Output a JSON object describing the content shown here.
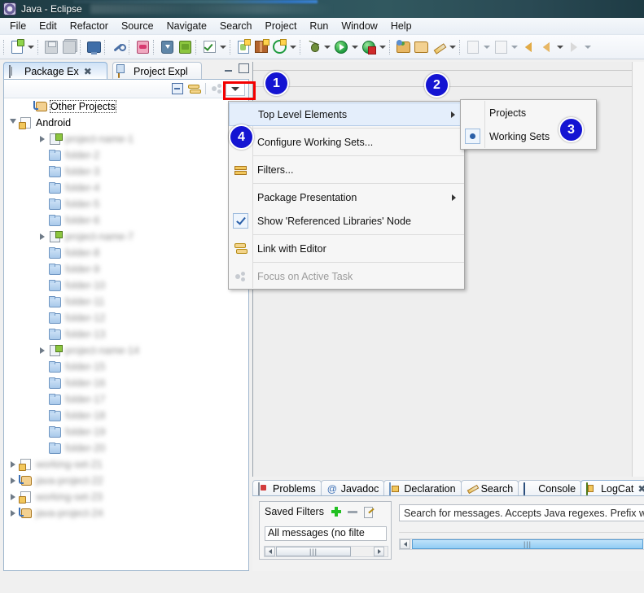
{
  "window": {
    "title": "Java - Eclipse",
    "app_icon": "eclipse-icon"
  },
  "menubar": {
    "items": [
      {
        "label": "File"
      },
      {
        "label": "Edit"
      },
      {
        "label": "Refactor"
      },
      {
        "label": "Source"
      },
      {
        "label": "Navigate"
      },
      {
        "label": "Search"
      },
      {
        "label": "Project"
      },
      {
        "label": "Run"
      },
      {
        "label": "Window"
      },
      {
        "label": "Help"
      }
    ]
  },
  "toolbar": {
    "icons": [
      "new-file-icon",
      "save-icon",
      "save-all-icon",
      "open-console-icon",
      "skip-breakpoints-icon",
      "android-sdk-manager-icon",
      "android-avd-manager-icon",
      "android-device-icon",
      "run-checked-icon",
      "new-java-class-icon",
      "new-java-package-icon",
      "run-target-icon",
      "debug-icon",
      "run-icon",
      "run-coverage-icon",
      "open-type-icon",
      "open-folder-icon",
      "search-pencil-icon",
      "annotation-icon",
      "next-annotation-icon",
      "back-icon",
      "forward-icon"
    ]
  },
  "package_explorer": {
    "tabs": [
      {
        "label": "Package Ex",
        "icon": "package-explorer-icon",
        "active": true,
        "closable": true
      },
      {
        "label": "Project Expl",
        "icon": "project-explorer-icon",
        "active": false,
        "closable": false
      }
    ],
    "window_buttons": [
      "minimize-icon",
      "maximize-icon"
    ],
    "view_toolbar": [
      "collapse-all-icon",
      "link-with-editor-icon",
      "focus-on-active-task-icon",
      "view-menu-icon"
    ],
    "tree": [
      {
        "label": "Other Projects",
        "icon": "other-projects-icon",
        "expander": "none",
        "blurred": false,
        "selected": true,
        "indent": 1
      },
      {
        "label": "Android",
        "icon": "working-set-icon",
        "expander": "open",
        "blurred": false,
        "selected": false,
        "indent": 0
      },
      {
        "label": "project-name-1",
        "icon": "android-project-icon",
        "expander": "closed",
        "blurred": true,
        "selected": false,
        "indent": 2
      },
      {
        "label": "folder-2",
        "icon": "folder-icon",
        "expander": "none",
        "blurred": true,
        "selected": false,
        "indent": 2
      },
      {
        "label": "folder-3",
        "icon": "folder-icon",
        "expander": "none",
        "blurred": true,
        "selected": false,
        "indent": 2
      },
      {
        "label": "folder-4",
        "icon": "folder-icon",
        "expander": "none",
        "blurred": true,
        "selected": false,
        "indent": 2
      },
      {
        "label": "folder-5",
        "icon": "folder-icon",
        "expander": "none",
        "blurred": true,
        "selected": false,
        "indent": 2
      },
      {
        "label": "folder-6",
        "icon": "folder-icon",
        "expander": "none",
        "blurred": true,
        "selected": false,
        "indent": 2
      },
      {
        "label": "project-name-7",
        "icon": "android-project-icon",
        "expander": "closed",
        "blurred": true,
        "selected": false,
        "indent": 2
      },
      {
        "label": "folder-8",
        "icon": "folder-icon",
        "expander": "none",
        "blurred": true,
        "selected": false,
        "indent": 2
      },
      {
        "label": "folder-9",
        "icon": "folder-icon",
        "expander": "none",
        "blurred": true,
        "selected": false,
        "indent": 2
      },
      {
        "label": "folder-10",
        "icon": "folder-icon",
        "expander": "none",
        "blurred": true,
        "selected": false,
        "indent": 2
      },
      {
        "label": "folder-11",
        "icon": "folder-icon",
        "expander": "none",
        "blurred": true,
        "selected": false,
        "indent": 2
      },
      {
        "label": "folder-12",
        "icon": "folder-icon",
        "expander": "none",
        "blurred": true,
        "selected": false,
        "indent": 2
      },
      {
        "label": "folder-13",
        "icon": "folder-icon",
        "expander": "none",
        "blurred": true,
        "selected": false,
        "indent": 2
      },
      {
        "label": "project-name-14",
        "icon": "android-project-icon",
        "expander": "closed",
        "blurred": true,
        "selected": false,
        "indent": 2
      },
      {
        "label": "folder-15",
        "icon": "folder-icon",
        "expander": "none",
        "blurred": true,
        "selected": false,
        "indent": 2
      },
      {
        "label": "folder-16",
        "icon": "folder-icon",
        "expander": "none",
        "blurred": true,
        "selected": false,
        "indent": 2
      },
      {
        "label": "folder-17",
        "icon": "folder-icon",
        "expander": "none",
        "blurred": true,
        "selected": false,
        "indent": 2
      },
      {
        "label": "folder-18",
        "icon": "folder-icon",
        "expander": "none",
        "blurred": true,
        "selected": false,
        "indent": 2
      },
      {
        "label": "folder-19",
        "icon": "folder-icon",
        "expander": "none",
        "blurred": true,
        "selected": false,
        "indent": 2
      },
      {
        "label": "folder-20",
        "icon": "folder-icon",
        "expander": "none",
        "blurred": true,
        "selected": false,
        "indent": 2
      },
      {
        "label": "working-set-21",
        "icon": "working-set-icon",
        "expander": "closed",
        "blurred": true,
        "selected": false,
        "indent": 0
      },
      {
        "label": "java-project-22",
        "icon": "java-project-icon",
        "expander": "closed",
        "blurred": true,
        "selected": false,
        "indent": 0
      },
      {
        "label": "working-set-23",
        "icon": "working-set-icon",
        "expander": "closed",
        "blurred": true,
        "selected": false,
        "indent": 0
      },
      {
        "label": "java-project-24",
        "icon": "java-project-icon",
        "expander": "closed",
        "blurred": true,
        "selected": false,
        "indent": 0
      }
    ]
  },
  "view_menu": {
    "items": [
      {
        "label": "Top Level Elements",
        "gutter": "none",
        "submenu": true,
        "highlighted": true,
        "disabled": false
      },
      {
        "label": "Configure Working Sets...",
        "gutter": "none",
        "submenu": false,
        "highlighted": false,
        "disabled": false
      },
      {
        "label": "Filters...",
        "gutter": "filter-icon",
        "submenu": false,
        "highlighted": false,
        "disabled": false
      },
      {
        "label": "Package Presentation",
        "gutter": "none",
        "submenu": true,
        "highlighted": false,
        "disabled": false
      },
      {
        "label": "Show 'Referenced Libraries' Node",
        "gutter": "checkbox-checked",
        "submenu": false,
        "highlighted": false,
        "disabled": false
      },
      {
        "label": "Link with Editor",
        "gutter": "link-with-editor-icon",
        "submenu": false,
        "highlighted": false,
        "disabled": false
      },
      {
        "label": "Focus on Active Task",
        "gutter": "focus-task-icon",
        "submenu": false,
        "highlighted": false,
        "disabled": true
      }
    ]
  },
  "top_level_submenu": {
    "items": [
      {
        "label": "Projects",
        "selected": false
      },
      {
        "label": "Working Sets",
        "selected": true
      }
    ]
  },
  "step_badges": [
    {
      "number": "1"
    },
    {
      "number": "2"
    },
    {
      "number": "3"
    },
    {
      "number": "4"
    }
  ],
  "bottom_panel": {
    "tabs": [
      {
        "label": "Problems",
        "icon": "problems-icon",
        "active": false,
        "closable": false
      },
      {
        "label": "Javadoc",
        "icon": "javadoc-icon",
        "active": false,
        "closable": false
      },
      {
        "label": "Declaration",
        "icon": "declaration-icon",
        "active": false,
        "closable": false
      },
      {
        "label": "Search",
        "icon": "search-icon",
        "active": false,
        "closable": false
      },
      {
        "label": "Console",
        "icon": "console-icon",
        "active": false,
        "closable": false
      },
      {
        "label": "LogCat",
        "icon": "logcat-icon",
        "active": true,
        "closable": true
      }
    ],
    "logcat": {
      "saved_filters_label": "Saved Filters",
      "add_icon": "add-filter-icon",
      "remove_icon": "remove-filter-icon",
      "edit_icon": "edit-filter-icon",
      "filter_list_item": "All messages (no filte",
      "search_placeholder": "Search for messages. Accepts Java regexes. Prefix w"
    }
  },
  "colors": {
    "badge": "#1414d2",
    "highlight_box": "#f40000",
    "tab_active": "#cfe2f6",
    "editor_bg": "#eeeeee"
  }
}
